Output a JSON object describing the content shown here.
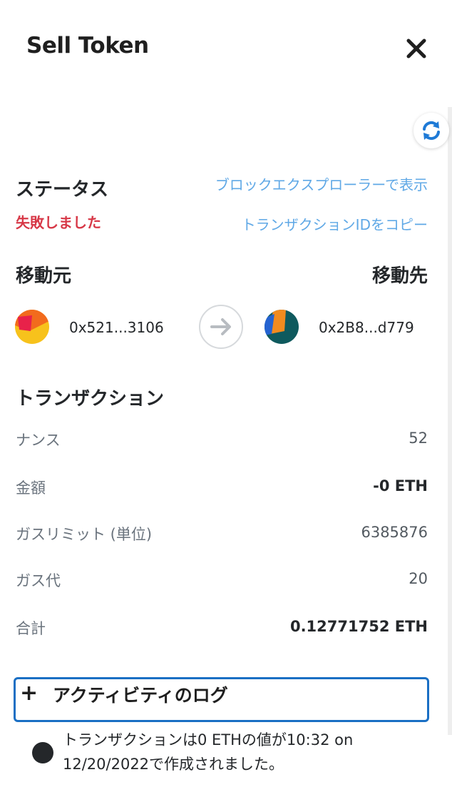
{
  "header": {
    "title": "Sell Token"
  },
  "status": {
    "heading": "ステータス",
    "value": "失敗しました",
    "explorer_link": "ブロックエクスプローラーで表示",
    "copy_id_link": "トランザクションIDをコピー"
  },
  "transfer": {
    "from_label": "移動元",
    "to_label": "移動先",
    "from_address": "0x521...3106",
    "to_address": "0x2B8...d779"
  },
  "transaction": {
    "heading": "トランザクション",
    "rows": [
      {
        "label": "ナンス",
        "value": "52"
      },
      {
        "label": "金額",
        "value": "-0 ETH"
      },
      {
        "label": "ガスリミット (単位)",
        "value": "6385876"
      },
      {
        "label": "ガス代",
        "value": "20"
      },
      {
        "label": "合計",
        "value": "0.12771752 ETH"
      }
    ]
  },
  "activity_log": {
    "title": "アクティビティのログ",
    "toggle_symbol": "+",
    "entry_line1": "トランザクションは0 ETHの値が10:32 on",
    "entry_line2": "12/20/2022で作成されました。"
  },
  "colors": {
    "accent_link": "#5fa8e6",
    "error": "#d73847",
    "focus_border": "#1a6fc4",
    "refresh_icon": "#1e7ad6"
  }
}
